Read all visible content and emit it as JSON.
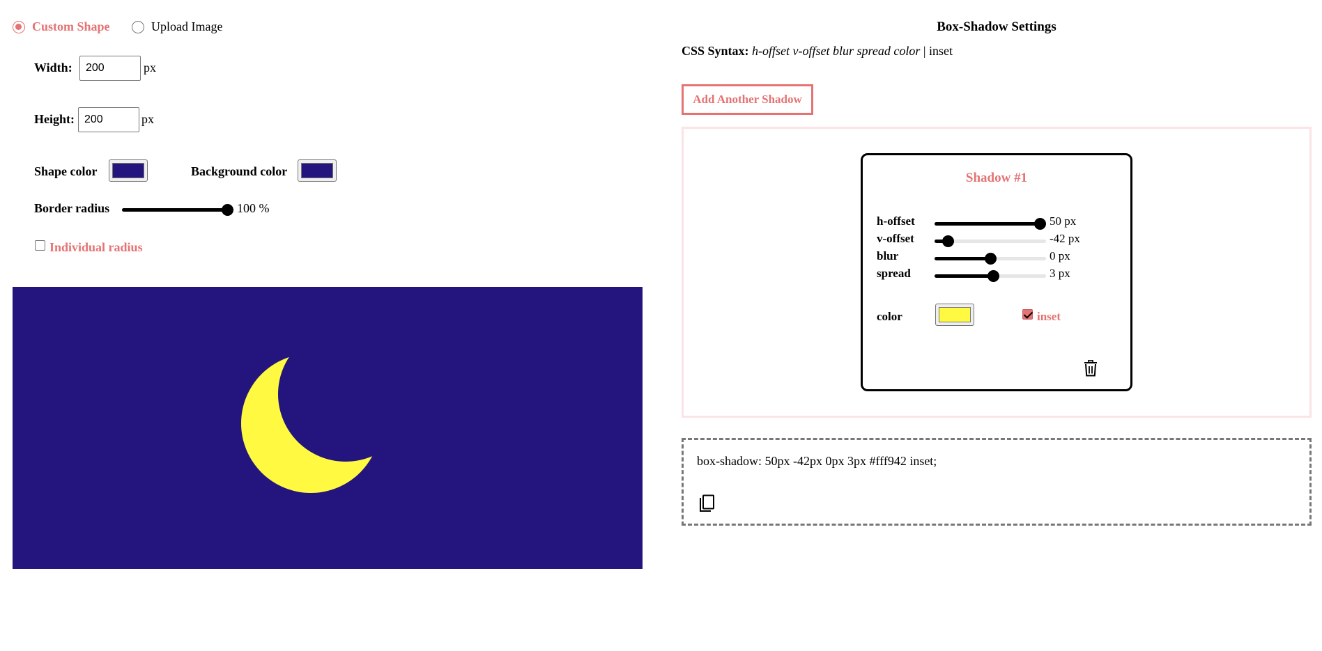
{
  "mode": {
    "options": [
      {
        "label": "Custom Shape",
        "selected": true
      },
      {
        "label": "Upload Image",
        "selected": false
      }
    ]
  },
  "shape": {
    "width_label": "Width:",
    "width_value": "200",
    "height_label": "Height:",
    "height_value": "200",
    "unit": "px",
    "shape_color_label": "Shape color",
    "shape_color": "#23157d",
    "background_color_label": "Background color",
    "background_color": "#23157d",
    "border_radius_label": "Border radius",
    "border_radius_value": 100,
    "border_radius_text": "100 %",
    "individual_radius_label": "Individual radius",
    "individual_radius_checked": false
  },
  "settings": {
    "title": "Box-Shadow Settings",
    "syntax_label": "CSS Syntax:",
    "syntax_value": "h-offset v-offset blur spread color",
    "syntax_sep": "|",
    "syntax_inset": "inset",
    "add_button": "Add Another Shadow"
  },
  "shadows": [
    {
      "title": "Shadow #1",
      "rows": [
        {
          "label": "h-offset",
          "value_text": "50 px",
          "fraction": 1.0
        },
        {
          "label": "v-offset",
          "value_text": "-42 px",
          "fraction": 0.08
        },
        {
          "label": "blur",
          "value_text": "0 px",
          "fraction": 0.5
        },
        {
          "label": "spread",
          "value_text": "3 px",
          "fraction": 0.53
        }
      ],
      "color_label": "color",
      "color": "#fff942",
      "inset_label": "inset",
      "inset_checked": true
    }
  ],
  "output": {
    "code": "box-shadow: 50px -42px 0px 3px #fff942 inset;"
  },
  "icons": {
    "delete": "trash-icon",
    "copy": "copy-icon"
  },
  "colors": {
    "accent": "#e57373",
    "preview_bg": "#23157d",
    "shadow_color": "#fff942"
  }
}
